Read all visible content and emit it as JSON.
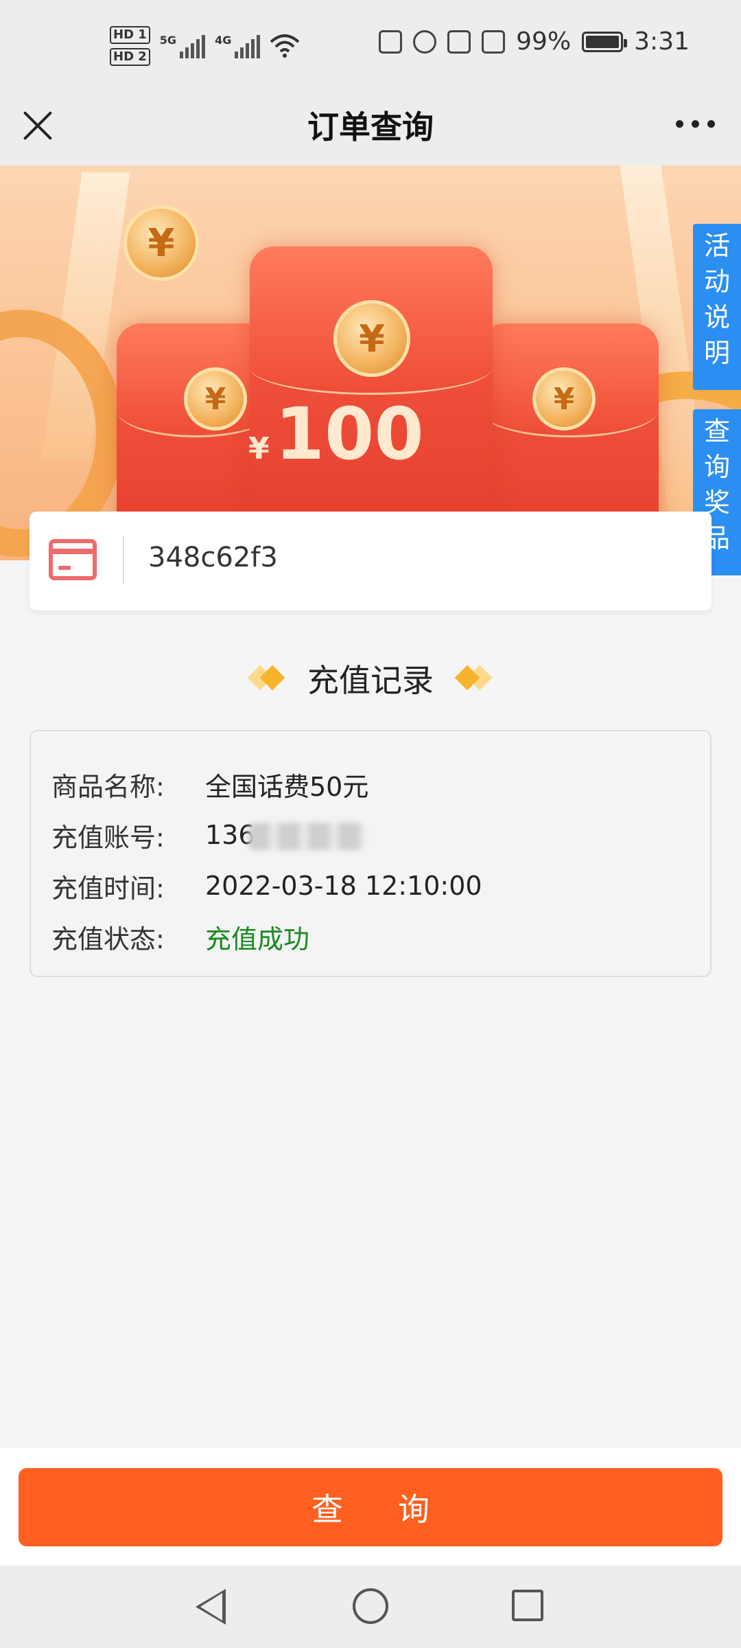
{
  "status_bar": {
    "sim1": "HD 1",
    "sim2": "HD 2",
    "net1": "5G",
    "net2": "4G",
    "battery": "99%",
    "time": "3:31"
  },
  "nav": {
    "title": "订单查询",
    "close_icon": "close-icon",
    "more_icon": "more-icon"
  },
  "banner": {
    "amount_symbol": "¥",
    "amount": "100",
    "coin_symbol": "¥"
  },
  "side_tabs": {
    "activity": "活动说明",
    "query_prize": "查询奖品"
  },
  "order": {
    "value": "348c62f3",
    "icon": "card-icon"
  },
  "section": {
    "title": "充值记录"
  },
  "record": {
    "rows": [
      {
        "label": "商品名称:",
        "value": "全国话费50元"
      },
      {
        "label": "充值账号:",
        "value": "136"
      },
      {
        "label": "充值时间:",
        "value": "2022-03-18 12:10:00"
      },
      {
        "label": "充值状态:",
        "value": "充值成功"
      }
    ],
    "status_color": "#1a8a22"
  },
  "button": {
    "query_label": "查询"
  },
  "colors": {
    "accent": "#ff5f1f",
    "side_tab": "#2b8ef3"
  }
}
